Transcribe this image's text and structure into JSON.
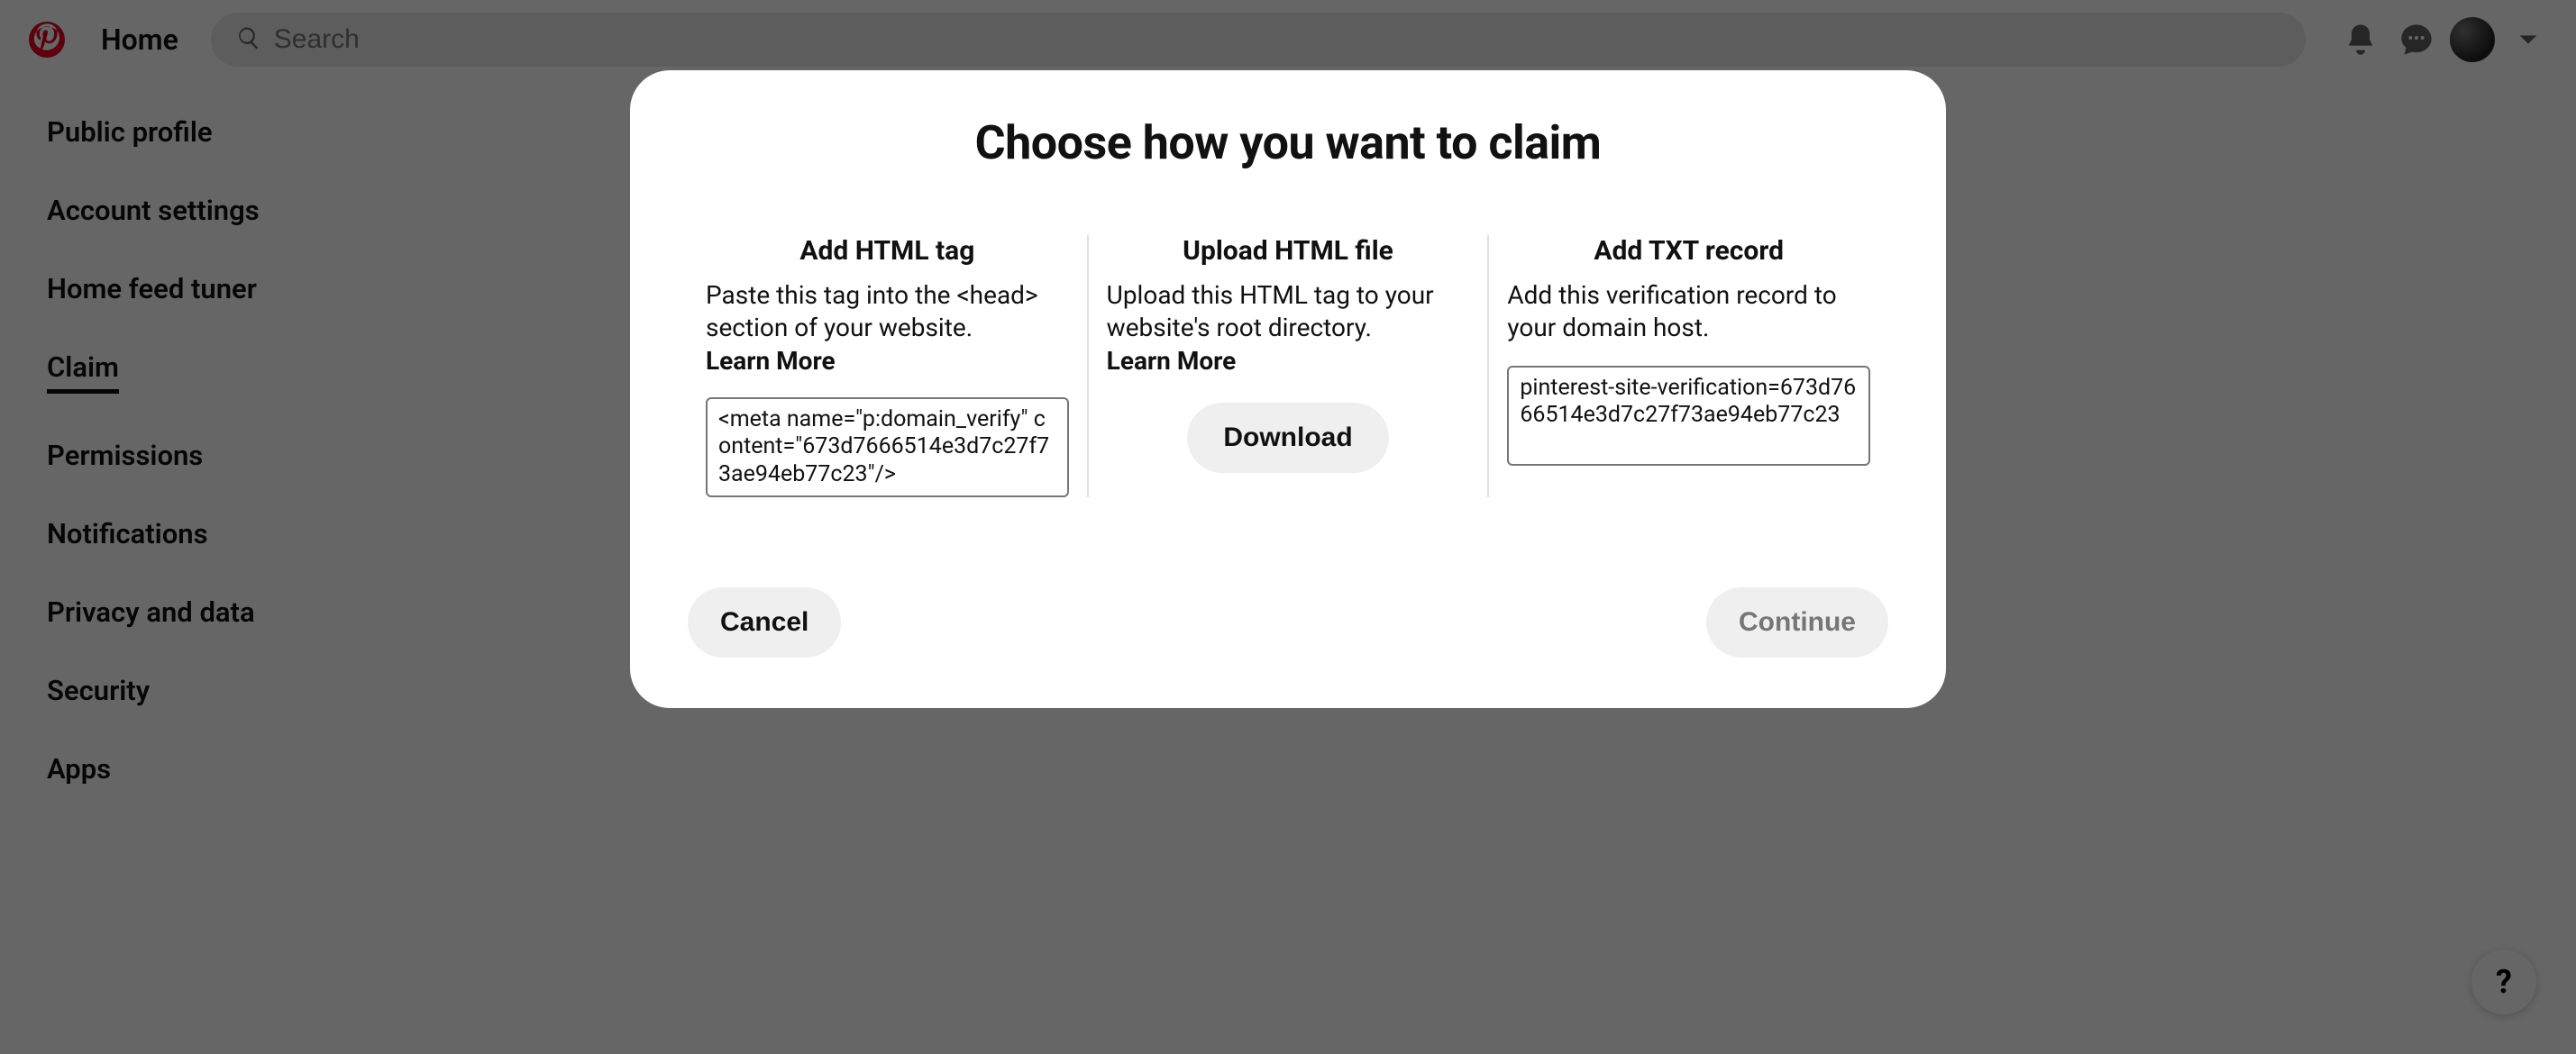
{
  "header": {
    "home_label": "Home",
    "search_placeholder": "Search"
  },
  "sidebar": {
    "items": [
      {
        "label": "Public profile"
      },
      {
        "label": "Account settings"
      },
      {
        "label": "Home feed tuner"
      },
      {
        "label": "Claim"
      },
      {
        "label": "Permissions"
      },
      {
        "label": "Notifications"
      },
      {
        "label": "Privacy and data"
      },
      {
        "label": "Security"
      },
      {
        "label": "Apps"
      }
    ],
    "active_index": 3
  },
  "modal": {
    "title": "Choose how you want to claim",
    "options": [
      {
        "title": "Add HTML tag",
        "desc": "Paste this tag into the <head> section of your website.",
        "learn_more": "Learn More",
        "code": "<meta name=\"p:domain_verify\" content=\"673d7666514e3d7c27f73ae94eb77c23\"/>"
      },
      {
        "title": "Upload HTML file",
        "desc": "Upload this HTML tag to your website's root directory.",
        "learn_more": "Learn More",
        "download_label": "Download"
      },
      {
        "title": "Add TXT record",
        "desc": "Add this verification record to your domain host.",
        "code": "pinterest-site-verification=673d7666514e3d7c27f73ae94eb77c23"
      }
    ],
    "cancel_label": "Cancel",
    "continue_label": "Continue"
  },
  "help_label": "?"
}
